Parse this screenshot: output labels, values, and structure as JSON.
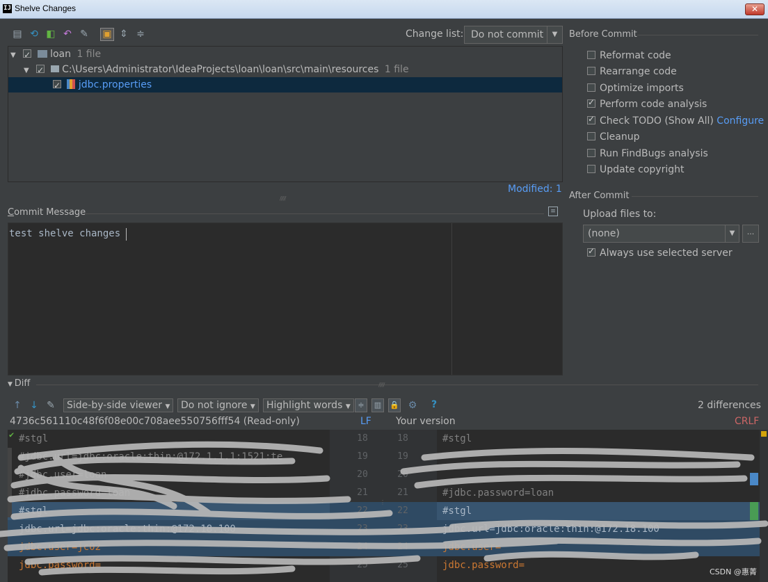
{
  "window": {
    "title": "Shelve Changes",
    "close_glyph": "✕"
  },
  "toolbar": {
    "icons": [
      "shelve-icon",
      "refresh-icon",
      "diff-icon",
      "rollback-icon",
      "edit-source-icon",
      "group-by-directory-icon",
      "expand-all-icon",
      "collapse-all-icon"
    ]
  },
  "changelist": {
    "label": "Change list:",
    "selected": "Do not commit"
  },
  "tree": {
    "rows": [
      {
        "label": "loan",
        "suffix": "1 file"
      },
      {
        "label": "C:\\Users\\Administrator\\IdeaProjects\\loan\\loan\\src\\main\\resources",
        "suffix": "1 file"
      },
      {
        "label": "jdbc.properties",
        "suffix": ""
      }
    ],
    "modified": "Modified: 1"
  },
  "commit": {
    "label": "Commit Message",
    "message": "test shelve changes"
  },
  "before_commit": {
    "title": "Before Commit",
    "options": [
      {
        "label": "Reformat code",
        "checked": false
      },
      {
        "label": "Rearrange code",
        "checked": false
      },
      {
        "label": "Optimize imports",
        "checked": false
      },
      {
        "label": "Perform code analysis",
        "checked": true
      },
      {
        "label": "Check TODO (Show All)",
        "checked": true
      },
      {
        "label": "Cleanup",
        "checked": false
      },
      {
        "label": "Run FindBugs analysis",
        "checked": false
      },
      {
        "label": "Update copyright",
        "checked": false
      }
    ],
    "configure_link": "Configure"
  },
  "after_commit": {
    "title": "After Commit",
    "upload_label": "Upload files to:",
    "upload_selected": "(none)",
    "more_button": "...",
    "always_use": "Always use selected server"
  },
  "diff": {
    "title": "Diff",
    "viewer": "Side-by-side viewer",
    "ignore": "Do not ignore",
    "highlight": "Highlight words",
    "differences": "2 differences",
    "left_header": "4736c561110c48f6f08e00c708aee550756fff54 (Read-only)",
    "lf": "LF",
    "right_header": "Your version",
    "crlf": "CRLF",
    "left_lines": [
      "#stgl",
      "#jdbc.url=jdbc:oracle:thin:@172.1.1.1:1521:te",
      "#jdbc.user=loan",
      "#jdbc.password=loan",
      "#stgl",
      "jdbc.url=jdbc:oracle:thin:@172.18.100",
      "jdbc.user=jc02",
      "jdbc.password="
    ],
    "right_lines": [
      "#stgl",
      "",
      "",
      "#jdbc.password=loan",
      "#stgl",
      "jdbc.url=jdbc:oracle:thin:@172.18.100",
      "jdbc.user=",
      "jdbc.password="
    ],
    "left_numbers": [
      "18",
      "19",
      "20",
      "21",
      "22",
      "23",
      "24",
      "25"
    ],
    "right_numbers": [
      "18",
      "19",
      "20",
      "21",
      "22",
      "23",
      "24",
      "25"
    ]
  },
  "watermark": "CSDN @惠菁",
  "colors": {
    "accent": "#589df6",
    "selection": "#0d293e",
    "crlf": "#cc6666"
  }
}
